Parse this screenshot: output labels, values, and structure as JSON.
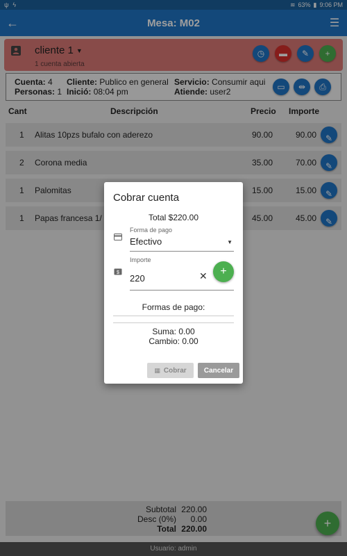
{
  "statusbar": {
    "battery": "63%",
    "time": "9:06 PM"
  },
  "appbar": {
    "title": "Mesa: M02"
  },
  "client": {
    "name": "cliente 1",
    "subtitle": "1 cuenta abierta"
  },
  "info": {
    "cuenta_label": "Cuenta:",
    "cuenta_value": "4",
    "personas_label": "Personas:",
    "personas_value": "1",
    "cliente_label": "Cliente:",
    "cliente_value": "Publico en general",
    "inicio_label": "Inició:",
    "inicio_value": "08:04 pm",
    "servicio_label": "Servicio:",
    "servicio_value": "Consumir aqui",
    "atiende_label": "Atiende:",
    "atiende_value": "user2"
  },
  "table": {
    "headers": {
      "cant": "Cant",
      "descripcion": "Descripción",
      "precio": "Precio",
      "importe": "Importe"
    },
    "rows": [
      {
        "cant": "1",
        "descripcion": "Alitas 10pzs bufalo con aderezo",
        "precio": "90.00",
        "importe": "90.00"
      },
      {
        "cant": "2",
        "descripcion": "Corona media",
        "precio": "35.00",
        "importe": "70.00"
      },
      {
        "cant": "1",
        "descripcion": "Palomitas",
        "precio": "15.00",
        "importe": "15.00"
      },
      {
        "cant": "1",
        "descripcion": "Papas francesa 1/",
        "precio": "45.00",
        "importe": "45.00"
      }
    ]
  },
  "dialog": {
    "title": "Cobrar cuenta",
    "total": "Total $220.00",
    "forma_label": "Forma de pago",
    "forma_value": "Efectivo",
    "importe_label": "Importe",
    "importe_value": "220",
    "formas_title": "Formas de pago:",
    "suma": "Suma: 0.00",
    "cambio": "Cambio: 0.00",
    "cobrar": "Cobrar",
    "cancelar": "Cancelar"
  },
  "footer": {
    "subtotal_label": "Subtotal",
    "subtotal_value": "220.00",
    "desc_label": "Desc (0%)",
    "desc_value": "0.00",
    "total_label": "Total",
    "total_value": "220.00"
  },
  "usuario": "Usuario: admin",
  "colors": {
    "primary": "#1f74c6",
    "danger": "#d9302c",
    "success": "#4caf50",
    "client_card": "#dc7a77"
  }
}
